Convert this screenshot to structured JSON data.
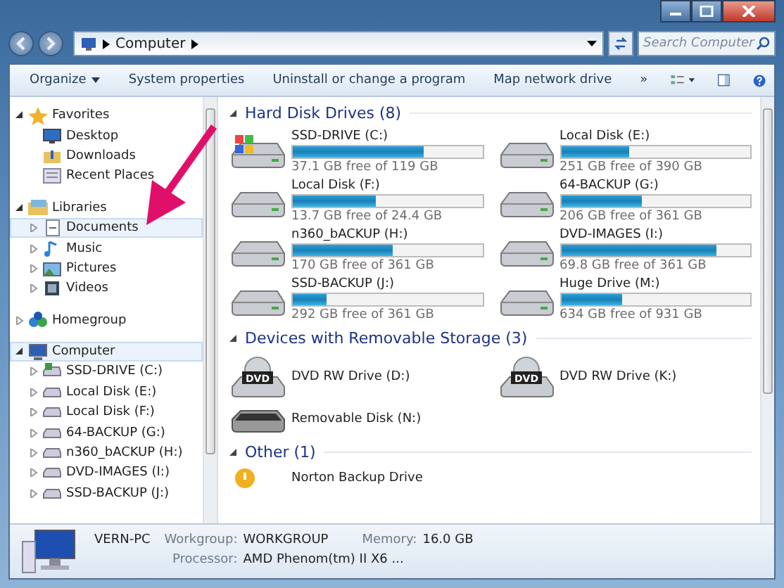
{
  "address": {
    "path": [
      "Computer"
    ]
  },
  "search": {
    "placeholder": "Search Computer"
  },
  "toolbar": {
    "buttons": [
      {
        "label": "Organize",
        "dropdown": true
      },
      {
        "label": "System properties",
        "dropdown": false
      },
      {
        "label": "Uninstall or change a program",
        "dropdown": false
      },
      {
        "label": "Map network drive",
        "dropdown": false
      }
    ],
    "overflow": "»"
  },
  "sidebar": {
    "groups": [
      {
        "label": "Favorites",
        "expanded": true,
        "selected": false,
        "children": [
          {
            "label": "Desktop",
            "expandable": false,
            "selected": false
          },
          {
            "label": "Downloads",
            "expandable": false,
            "selected": false
          },
          {
            "label": "Recent Places",
            "expandable": false,
            "selected": false
          }
        ]
      },
      {
        "label": "Libraries",
        "expanded": true,
        "selected": false,
        "children": [
          {
            "label": "Documents",
            "expandable": true,
            "selected": true
          },
          {
            "label": "Music",
            "expandable": true,
            "selected": false
          },
          {
            "label": "Pictures",
            "expandable": true,
            "selected": false
          },
          {
            "label": "Videos",
            "expandable": true,
            "selected": false
          }
        ]
      },
      {
        "label": "Homegroup",
        "expanded": false,
        "selected": false
      },
      {
        "label": "Computer",
        "expanded": true,
        "selected": true,
        "children": [
          {
            "label": "SSD-DRIVE (C:)",
            "expandable": true,
            "selected": false
          },
          {
            "label": "Local Disk (E:)",
            "expandable": true,
            "selected": false
          },
          {
            "label": "Local Disk (F:)",
            "expandable": true,
            "selected": false
          },
          {
            "label": "64-BACKUP (G:)",
            "expandable": true,
            "selected": false
          },
          {
            "label": "n360_bACKUP (H:)",
            "expandable": true,
            "selected": false
          },
          {
            "label": "DVD-IMAGES (I:)",
            "expandable": true,
            "selected": false
          },
          {
            "label": "SSD-BACKUP (J:)",
            "expandable": true,
            "selected": false
          }
        ]
      }
    ]
  },
  "content": {
    "groups": [
      {
        "title": "Hard Disk Drives (8)",
        "items": [
          {
            "kind": "system-drive",
            "name": "SSD-DRIVE (C:)",
            "level": 0.69,
            "free": "37.1 GB free of 119 GB"
          },
          {
            "kind": "drive",
            "name": "Local Disk (E:)",
            "level": 0.36,
            "free": "251 GB free of 390 GB"
          },
          {
            "kind": "drive",
            "name": "Local Disk (F:)",
            "level": 0.44,
            "free": "13.7 GB free of 24.4 GB"
          },
          {
            "kind": "drive",
            "name": "64-BACKUP (G:)",
            "level": 0.43,
            "free": "206 GB free of 361 GB"
          },
          {
            "kind": "drive",
            "name": "n360_bACKUP (H:)",
            "level": 0.53,
            "free": "170 GB free of 361 GB"
          },
          {
            "kind": "drive",
            "name": "DVD-IMAGES (I:)",
            "level": 0.82,
            "free": "69.8 GB free of 361 GB"
          },
          {
            "kind": "drive",
            "name": "SSD-BACKUP (J:)",
            "level": 0.18,
            "free": "292 GB free of 361 GB"
          },
          {
            "kind": "drive",
            "name": "Huge Drive (M:)",
            "level": 0.32,
            "free": "634 GB free of 931 GB"
          }
        ]
      },
      {
        "title": "Devices with Removable Storage (3)",
        "items": [
          {
            "kind": "dvd",
            "name": "DVD RW Drive (D:)",
            "disc_label": "DVD"
          },
          {
            "kind": "dvd",
            "name": "DVD RW Drive (K:)",
            "disc_label": "DVD"
          },
          {
            "kind": "removable",
            "name": "Removable Disk (N:)"
          }
        ]
      },
      {
        "title": "Other (1)",
        "items": [
          {
            "kind": "other",
            "name": "Norton Backup Drive"
          }
        ]
      }
    ]
  },
  "details": {
    "name": "VERN-PC",
    "fields": [
      {
        "label": "Workgroup:",
        "value": "WORKGROUP"
      },
      {
        "label": "Memory:",
        "value": "16.0 GB"
      },
      {
        "label": "Processor:",
        "value": "AMD Phenom(tm) II X6 ..."
      }
    ]
  }
}
